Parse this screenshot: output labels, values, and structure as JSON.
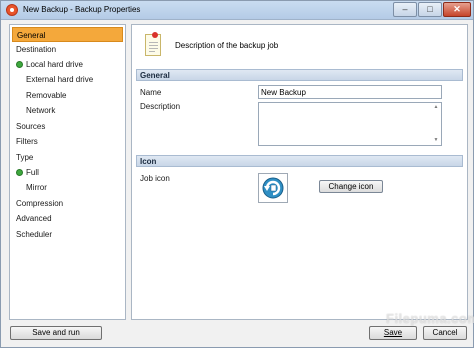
{
  "window": {
    "title": "New Backup - Backup Properties",
    "minimize_label": "–",
    "maximize_label": "□",
    "close_label": "✕"
  },
  "sidebar": {
    "items": [
      {
        "label": "General",
        "selected": true
      },
      {
        "label": "Destination"
      },
      {
        "label": "Local hard drive",
        "bullet": true
      },
      {
        "label": "External hard drive"
      },
      {
        "label": "Removable"
      },
      {
        "label": "Network"
      },
      {
        "label": "Sources"
      },
      {
        "label": "Filters"
      },
      {
        "label": "Type"
      },
      {
        "label": "Full",
        "bullet": true
      },
      {
        "label": "Mirror"
      },
      {
        "label": "Compression"
      },
      {
        "label": "Advanced"
      },
      {
        "label": "Scheduler"
      }
    ]
  },
  "header": {
    "description": "Description of the backup job"
  },
  "general_section": {
    "title": "General",
    "name_label": "Name",
    "name_value": "New Backup",
    "description_label": "Description",
    "description_value": ""
  },
  "icon_section": {
    "title": "Icon",
    "job_icon_label": "Job icon",
    "change_icon_button": "Change icon"
  },
  "buttons": {
    "save_and_run": "Save and run",
    "save": "Save",
    "cancel": "Cancel"
  },
  "watermark": "Filepuma.com",
  "colors": {
    "accent_selected": "#f4a83b",
    "bullet_green": "#3ea83e",
    "section_header": "#c8d6e7"
  }
}
